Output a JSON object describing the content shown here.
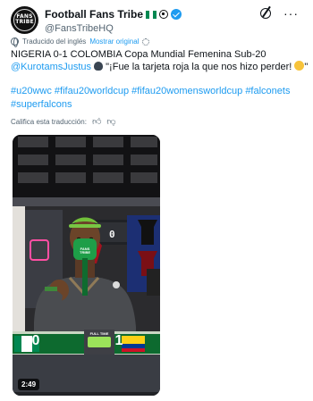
{
  "author": {
    "display_name": "Football Fans Tribe",
    "handle": "@FansTribeHQ",
    "avatar_text": "FANS TRIBE",
    "icons": [
      "nigeria-flag-icon",
      "soccer-ball-icon",
      "verified-badge-icon"
    ]
  },
  "toolbar": {
    "icons": [
      "grok-icon",
      "more-icon"
    ],
    "more_label": "···"
  },
  "translation": {
    "notice": "Traducido del inglés",
    "show_original": "Mostrar original"
  },
  "tweet": {
    "line1": "NIGERIA 0-1 COLOMBIA Copa Mundial Femenina Sub-20",
    "mention": "@KurotamsJustus",
    "quote": "\"¡Fue la tarjeta roja la que nos hizo perder!",
    "quote_end": "\"",
    "hashtags_line1": "#u20wwc #fifau20worldcup #fifau20womensworldcup #falconets",
    "hashtags_line2": "#superfalcons"
  },
  "rating": {
    "prompt": "Califica esta traducción:",
    "icons": [
      "thumbs-up-icon",
      "thumbs-down-icon"
    ]
  },
  "video": {
    "duration": "2:49",
    "screen_digit": "0",
    "mic_label": "FANS TRIBE",
    "scoreboard": {
      "status": "FULL TIME",
      "home_team": "Nigeria",
      "home_score": "0",
      "away_team": "Colombia",
      "away_score": "1"
    }
  },
  "colors": {
    "accent": "#1d9bf0",
    "text": "#0f1419",
    "muted": "#536471",
    "scoreboard_green": "#0a6b2e"
  }
}
